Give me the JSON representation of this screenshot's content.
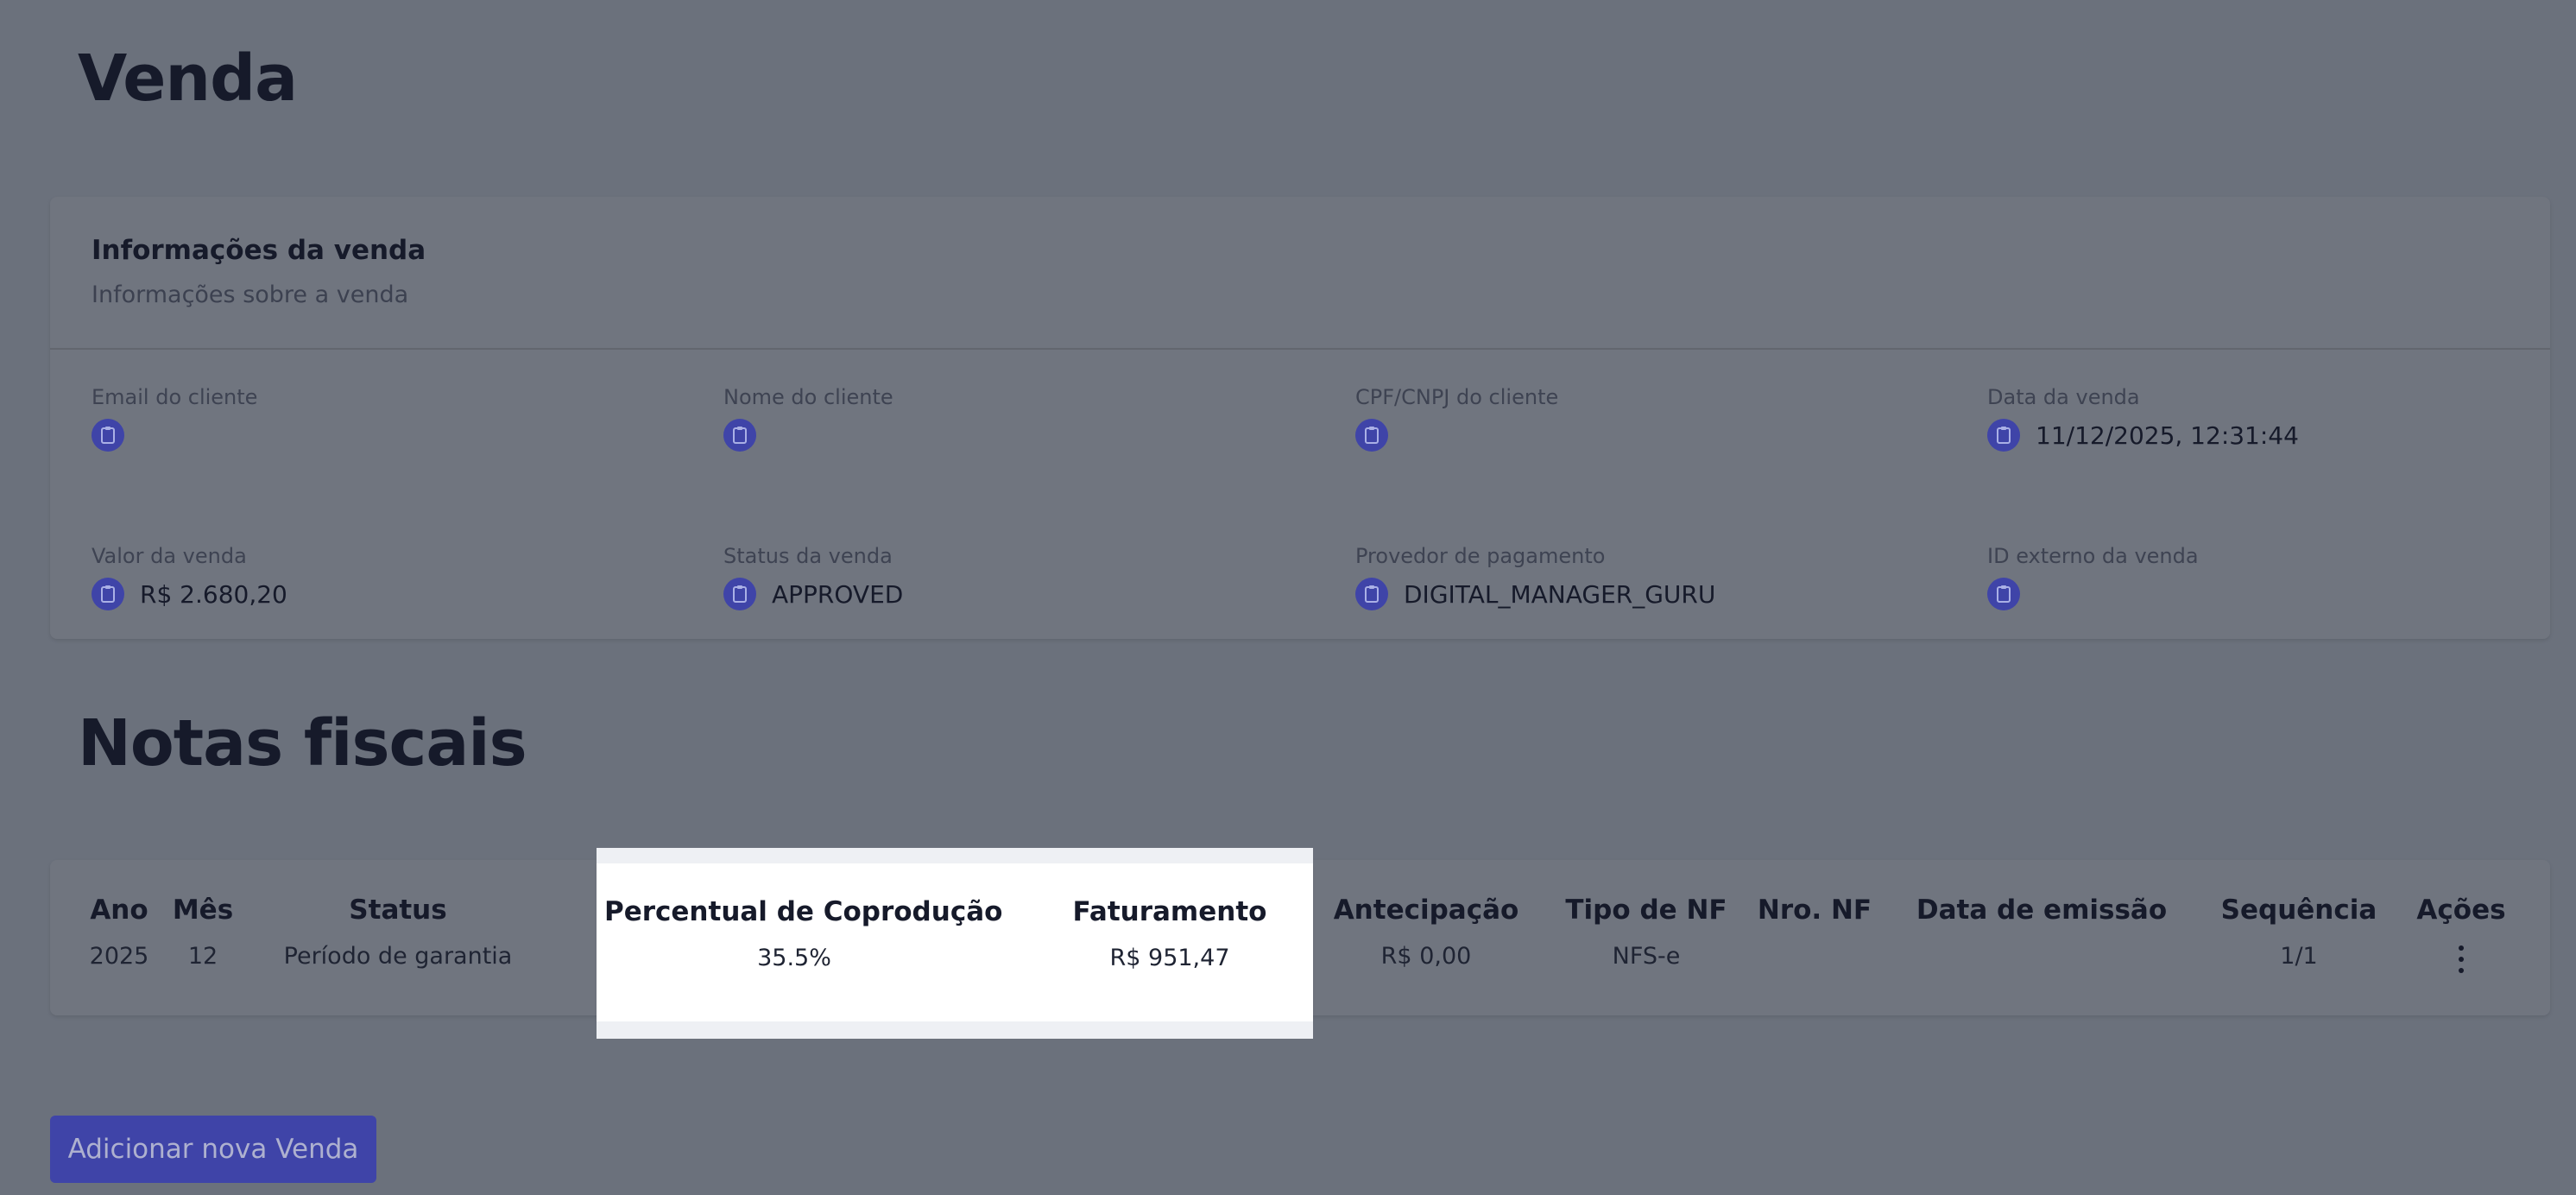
{
  "page": {
    "title": "Venda"
  },
  "info": {
    "title": "Informações da venda",
    "subtitle": "Informações sobre a venda",
    "fields": [
      {
        "label": "Email do cliente",
        "value": ""
      },
      {
        "label": "Nome do cliente",
        "value": ""
      },
      {
        "label": "CPF/CNPJ do cliente",
        "value": ""
      },
      {
        "label": "Data da venda",
        "value": "11/12/2025, 12:31:44"
      },
      {
        "label": "Valor da venda",
        "value": "R$ 2.680,20"
      },
      {
        "label": "Status da venda",
        "value": "APPROVED"
      },
      {
        "label": "Provedor de pagamento",
        "value": "DIGITAL_MANAGER_GURU"
      },
      {
        "label": "ID externo da venda",
        "value": ""
      }
    ]
  },
  "notas": {
    "title": "Notas fiscais",
    "columns": [
      {
        "header": "Ano",
        "value": "2025"
      },
      {
        "header": "Mês",
        "value": "12"
      },
      {
        "header": "Status",
        "value": "Período de garantia"
      },
      {
        "header": "Percentual de Coprodução",
        "value": "35.5%"
      },
      {
        "header": "Faturamento",
        "value": "R$ 951,47"
      },
      {
        "header": "Antecipação",
        "value": "R$ 0,00"
      },
      {
        "header": "Tipo de NF",
        "value": "NFS-e"
      },
      {
        "header": "Nro. NF",
        "value": ""
      },
      {
        "header": "Data de emissão",
        "value": ""
      },
      {
        "header": "Sequência",
        "value": "1/1"
      },
      {
        "header": "Ações",
        "value": ""
      }
    ]
  },
  "actions": {
    "add_label": "Adicionar nova Venda"
  },
  "icons": {
    "field_badge": "clipboard-icon",
    "row_actions": "kebab-menu-icon"
  },
  "colors": {
    "accent": "#3f44a8",
    "overlay": "#6b717c",
    "text_dark": "#161a2a"
  }
}
